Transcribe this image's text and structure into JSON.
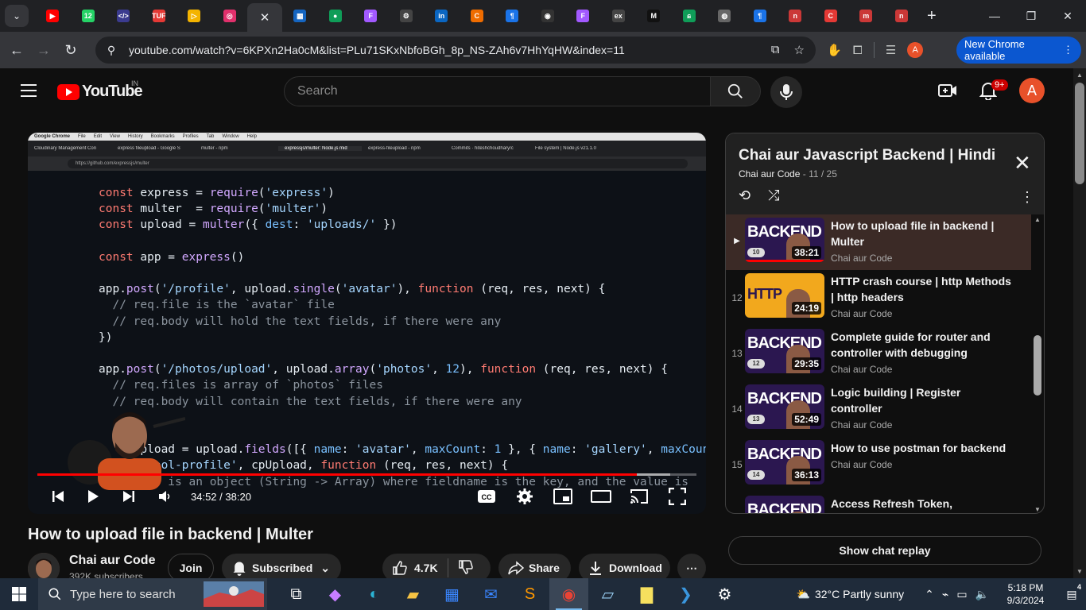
{
  "browser": {
    "tabs": [
      {
        "icon": "youtube-icon",
        "color": "#ff0000",
        "glyph": "▶"
      },
      {
        "icon": "whatsapp-icon",
        "color": "#25d366",
        "glyph": "12"
      },
      {
        "icon": "code-icon",
        "color": "#3b3b8f",
        "glyph": "</>"
      },
      {
        "icon": "tuf-icon",
        "color": "#e53935",
        "glyph": "TUF"
      },
      {
        "icon": "bookmark-icon",
        "color": "#f4b400",
        "glyph": "▷"
      },
      {
        "icon": "instagram-icon",
        "color": "#e1306c",
        "glyph": "◎"
      },
      {
        "icon": "bank-icon",
        "color": "#1565c0",
        "glyph": "▦"
      },
      {
        "icon": "leaf-icon",
        "color": "#0f9d58",
        "glyph": "●"
      },
      {
        "icon": "figma-icon",
        "color": "#a259ff",
        "glyph": "F"
      },
      {
        "icon": "chatgpt-icon",
        "color": "#444",
        "glyph": "⚙"
      },
      {
        "icon": "linkedin-icon",
        "color": "#0a66c2",
        "glyph": "in"
      },
      {
        "icon": "codecademy-icon",
        "color": "#ef6c00",
        "glyph": "C"
      },
      {
        "icon": "docs-icon",
        "color": "#1a73e8",
        "glyph": "¶"
      },
      {
        "icon": "github-icon",
        "color": "#333",
        "glyph": "◉"
      },
      {
        "icon": "figma-icon-2",
        "color": "#a259ff",
        "glyph": "F"
      },
      {
        "icon": "ex-icon",
        "color": "#444",
        "glyph": "ex"
      },
      {
        "icon": "medium-icon",
        "color": "#111",
        "glyph": "M"
      },
      {
        "icon": "leetcode-icon",
        "color": "#0f9d58",
        "glyph": "ɕ"
      },
      {
        "icon": "globe-icon",
        "color": "#666",
        "glyph": "◍"
      },
      {
        "icon": "docs-icon-2",
        "color": "#1a73e8",
        "glyph": "¶"
      },
      {
        "icon": "npm-icon",
        "color": "#cb3837",
        "glyph": "n"
      },
      {
        "icon": "loader-icon",
        "color": "#e53935",
        "glyph": "C"
      },
      {
        "icon": "npm-icon-2",
        "color": "#cb3837",
        "glyph": "m"
      },
      {
        "icon": "npm-icon-3",
        "color": "#cb3837",
        "glyph": "n"
      }
    ],
    "url": "youtube.com/watch?v=6KPXn2Ha0cM&list=PLu71SKxNbfoBGh_8p_NS-ZAh6v7HhYqHW&index=11",
    "profile_letter": "A",
    "new_chrome": "New Chrome available"
  },
  "youtube": {
    "logo": "YouTube",
    "country": "IN",
    "search_placeholder": "Search",
    "notif_count": "9+",
    "avatar_letter": "A"
  },
  "video": {
    "screen": {
      "mac_menu": [
        "Google Chrome",
        "File",
        "Edit",
        "View",
        "History",
        "Bookmarks",
        "Profiles",
        "Tab",
        "Window",
        "Help"
      ],
      "tabs": [
        "Cloudinary Management Con",
        "express fileupload - Google S",
        "multer - npm",
        "expressjs/multer: Node.js mid",
        "express-fileupload - npm",
        "Commits · hiteshchoudhary/c",
        "File system | Node.js v21.1.0"
      ],
      "url": "https://github.com/expressjs/multer"
    },
    "current_time": "34:52",
    "duration": "38:20",
    "played_fraction": 0.9096,
    "buffered_fraction": 0.96
  },
  "meta": {
    "title": "How to upload file in backend | Multer",
    "channel": "Chai aur Code",
    "subscribers": "392K subscribers",
    "join": "Join",
    "subscribed": "Subscribed",
    "likes": "4.7K",
    "share": "Share",
    "download": "Download"
  },
  "playlist": {
    "title": "Chai aur Javascript Backend | Hindi",
    "channel": "Chai aur Code",
    "position": "11 / 25",
    "items": [
      {
        "index": "▶",
        "ep": "10",
        "duration": "38:21",
        "title": "How to upload file in backend | Multer",
        "channel": "Chai aur Code",
        "current": true,
        "thumb": "BACKEND"
      },
      {
        "index": "12",
        "ep": "",
        "duration": "24:19",
        "title": "HTTP crash course | http Methods | http headers",
        "channel": "Chai aur Code",
        "current": false,
        "thumb": "HTTP"
      },
      {
        "index": "13",
        "ep": "12",
        "duration": "29:35",
        "title": "Complete guide for router and controller with debugging",
        "channel": "Chai aur Code",
        "current": false,
        "thumb": "BACKEND"
      },
      {
        "index": "14",
        "ep": "13",
        "duration": "52:49",
        "title": "Logic building | Register controller",
        "channel": "Chai aur Code",
        "current": false,
        "thumb": "BACKEND"
      },
      {
        "index": "15",
        "ep": "14",
        "duration": "36:13",
        "title": "How to use postman for backend",
        "channel": "Chai aur Code",
        "current": false,
        "thumb": "BACKEND"
      },
      {
        "index": "",
        "ep": "",
        "duration": "",
        "title": "Access Refresh Token,",
        "channel": "",
        "current": false,
        "thumb": "BACKEND"
      }
    ],
    "chat_replay": "Show chat replay"
  },
  "taskbar": {
    "search_placeholder": "Type here to search",
    "weather": "32°C  Partly sunny",
    "time": "5:18 PM",
    "date": "9/3/2024",
    "notifications": "4",
    "apps": [
      "task-view-icon",
      "copilot-icon",
      "edge-icon",
      "file-explorer-icon",
      "store-icon",
      "mail-icon",
      "sublime-icon",
      "chrome-icon",
      "notes-icon",
      "sticky-notes-icon",
      "vscode-icon",
      "settings-icon"
    ]
  }
}
